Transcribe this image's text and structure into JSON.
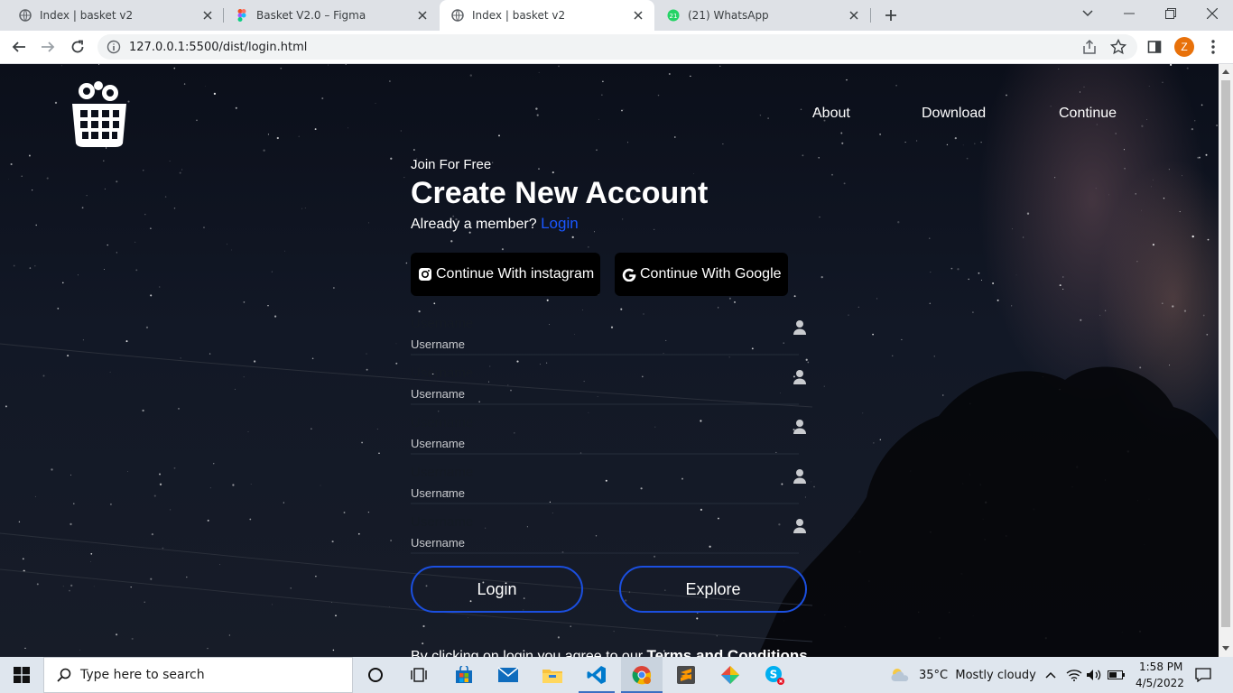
{
  "browser": {
    "tabs": [
      {
        "label": "Index | basket v2",
        "active": false
      },
      {
        "label": "Basket V2.0 – Figma",
        "active": false
      },
      {
        "label": "Index | basket v2",
        "active": true
      },
      {
        "label": "(21) WhatsApp",
        "active": false
      }
    ],
    "url": "127.0.0.1:5500/dist/login.html",
    "profile_initial": "Z"
  },
  "page": {
    "nav": [
      "About",
      "Download",
      "Continue"
    ],
    "join_label": "Join For Free",
    "title": "Create New Account",
    "member_text": "Already a member?",
    "login_link": "Login",
    "social": {
      "instagram": "Continue With instagram",
      "google": "Continue With Google"
    },
    "fields": [
      {
        "placeholder": "Username",
        "label": "Username"
      },
      {
        "placeholder": "Username",
        "label": "Username"
      },
      {
        "placeholder": "Username",
        "label": "Username"
      },
      {
        "placeholder": "Username",
        "label": "Username"
      },
      {
        "placeholder": "Username",
        "label": "Username"
      }
    ],
    "buttons": {
      "login": "Login",
      "explore": "Explore"
    },
    "terms_prefix": "By clicking on login you agree to our",
    "terms_link": "Terms and Conditions"
  },
  "taskbar": {
    "search_placeholder": "Type here to search",
    "weather": "35°C  Mostly cloudy",
    "time": "1:58 PM",
    "date": "4/5/2022"
  },
  "colors": {
    "accent_blue": "#1a57ff",
    "pill_border": "#1b4fe0",
    "avatar": "#e8710a"
  }
}
